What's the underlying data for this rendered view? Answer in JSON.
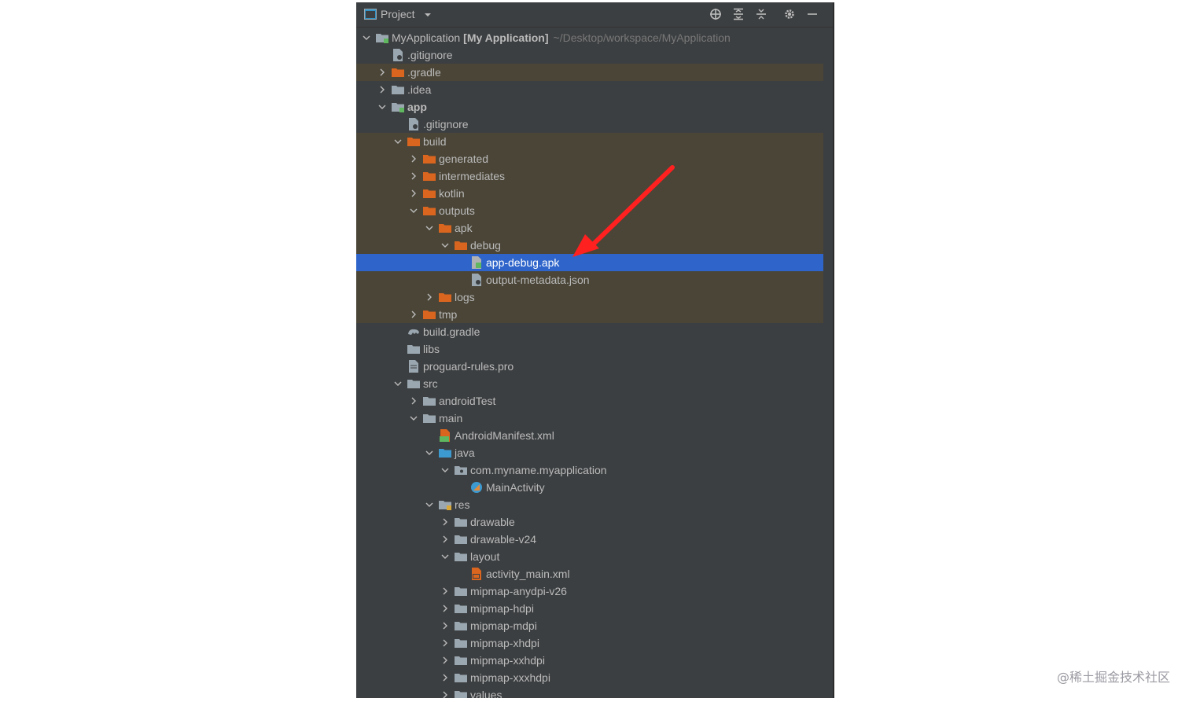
{
  "panel": {
    "title": "Project"
  },
  "toolbar": {
    "icons": [
      "locate-icon",
      "expand-all-icon",
      "collapse-all-icon",
      "gear-icon",
      "minimize-icon"
    ]
  },
  "tree": [
    {
      "label": "MyApplication",
      "bold_suffix": "[My Application]",
      "path": "~/Desktop/workspace/MyApplication",
      "depth": 0,
      "chevron": "down",
      "icon": "module-folder",
      "style": "normal"
    },
    {
      "label": ".gitignore",
      "depth": 1,
      "chevron": "none",
      "icon": "gitignore-file",
      "style": "normal"
    },
    {
      "label": ".gradle",
      "depth": 1,
      "chevron": "right",
      "icon": "orange-folder",
      "style": "excluded"
    },
    {
      "label": ".idea",
      "depth": 1,
      "chevron": "right",
      "icon": "grey-folder",
      "style": "normal"
    },
    {
      "label": "app",
      "depth": 1,
      "chevron": "down",
      "icon": "module-folder",
      "style": "normal",
      "bold": true
    },
    {
      "label": ".gitignore",
      "depth": 2,
      "chevron": "none",
      "icon": "gitignore-file",
      "style": "normal"
    },
    {
      "label": "build",
      "depth": 2,
      "chevron": "down",
      "icon": "orange-folder",
      "style": "excluded"
    },
    {
      "label": "generated",
      "depth": 3,
      "chevron": "right",
      "icon": "orange-folder",
      "style": "excluded"
    },
    {
      "label": "intermediates",
      "depth": 3,
      "chevron": "right",
      "icon": "orange-folder",
      "style": "excluded"
    },
    {
      "label": "kotlin",
      "depth": 3,
      "chevron": "right",
      "icon": "orange-folder",
      "style": "excluded"
    },
    {
      "label": "outputs",
      "depth": 3,
      "chevron": "down",
      "icon": "orange-folder",
      "style": "excluded"
    },
    {
      "label": "apk",
      "depth": 4,
      "chevron": "down",
      "icon": "orange-folder",
      "style": "excluded"
    },
    {
      "label": "debug",
      "depth": 5,
      "chevron": "down",
      "icon": "orange-folder",
      "style": "excluded"
    },
    {
      "label": "app-debug.apk",
      "depth": 6,
      "chevron": "none",
      "icon": "apk-file",
      "style": "selected"
    },
    {
      "label": "output-metadata.json",
      "depth": 6,
      "chevron": "none",
      "icon": "json-file",
      "style": "excluded"
    },
    {
      "label": "logs",
      "depth": 4,
      "chevron": "right",
      "icon": "orange-folder",
      "style": "excluded"
    },
    {
      "label": "tmp",
      "depth": 3,
      "chevron": "right",
      "icon": "orange-folder",
      "style": "excluded"
    },
    {
      "label": "build.gradle",
      "depth": 2,
      "chevron": "none",
      "icon": "gradle-file",
      "style": "normal"
    },
    {
      "label": "libs",
      "depth": 2,
      "chevron": "none",
      "icon": "grey-folder",
      "style": "normal"
    },
    {
      "label": "proguard-rules.pro",
      "depth": 2,
      "chevron": "none",
      "icon": "text-file",
      "style": "normal"
    },
    {
      "label": "src",
      "depth": 2,
      "chevron": "down",
      "icon": "grey-folder",
      "style": "normal"
    },
    {
      "label": "androidTest",
      "depth": 3,
      "chevron": "right",
      "icon": "grey-folder",
      "style": "normal"
    },
    {
      "label": "main",
      "depth": 3,
      "chevron": "down",
      "icon": "grey-folder",
      "style": "normal"
    },
    {
      "label": "AndroidManifest.xml",
      "depth": 4,
      "chevron": "none",
      "icon": "manifest-file",
      "style": "normal"
    },
    {
      "label": "java",
      "depth": 4,
      "chevron": "down",
      "icon": "blue-folder",
      "style": "normal"
    },
    {
      "label": "com.myname.myapplication",
      "depth": 5,
      "chevron": "down",
      "icon": "package-folder",
      "style": "normal"
    },
    {
      "label": "MainActivity",
      "depth": 6,
      "chevron": "none",
      "icon": "kotlin-class",
      "style": "normal"
    },
    {
      "label": "res",
      "depth": 4,
      "chevron": "down",
      "icon": "res-folder",
      "style": "normal"
    },
    {
      "label": "drawable",
      "depth": 5,
      "chevron": "right",
      "icon": "grey-folder",
      "style": "normal"
    },
    {
      "label": "drawable-v24",
      "depth": 5,
      "chevron": "right",
      "icon": "grey-folder",
      "style": "normal"
    },
    {
      "label": "layout",
      "depth": 5,
      "chevron": "down",
      "icon": "grey-folder",
      "style": "normal"
    },
    {
      "label": "activity_main.xml",
      "depth": 6,
      "chevron": "none",
      "icon": "layout-file",
      "style": "normal"
    },
    {
      "label": "mipmap-anydpi-v26",
      "depth": 5,
      "chevron": "right",
      "icon": "grey-folder",
      "style": "normal"
    },
    {
      "label": "mipmap-hdpi",
      "depth": 5,
      "chevron": "right",
      "icon": "grey-folder",
      "style": "normal"
    },
    {
      "label": "mipmap-mdpi",
      "depth": 5,
      "chevron": "right",
      "icon": "grey-folder",
      "style": "normal"
    },
    {
      "label": "mipmap-xhdpi",
      "depth": 5,
      "chevron": "right",
      "icon": "grey-folder",
      "style": "normal"
    },
    {
      "label": "mipmap-xxhdpi",
      "depth": 5,
      "chevron": "right",
      "icon": "grey-folder",
      "style": "normal"
    },
    {
      "label": "mipmap-xxxhdpi",
      "depth": 5,
      "chevron": "right",
      "icon": "grey-folder",
      "style": "normal"
    },
    {
      "label": "values",
      "depth": 5,
      "chevron": "right",
      "icon": "grey-folder",
      "style": "normal"
    }
  ],
  "annotation": {
    "arrow_color": "#ff2020",
    "points_to": "app-debug.apk"
  },
  "watermark": "@稀土掘金技术社区",
  "colors": {
    "panel_bg": "#3c3f41",
    "excluded_bg": "#4a4537",
    "selected_bg": "#2f65ca",
    "text": "#bbbbbb",
    "orange_folder": "#d9651f",
    "grey_folder": "#9aa7b0"
  }
}
